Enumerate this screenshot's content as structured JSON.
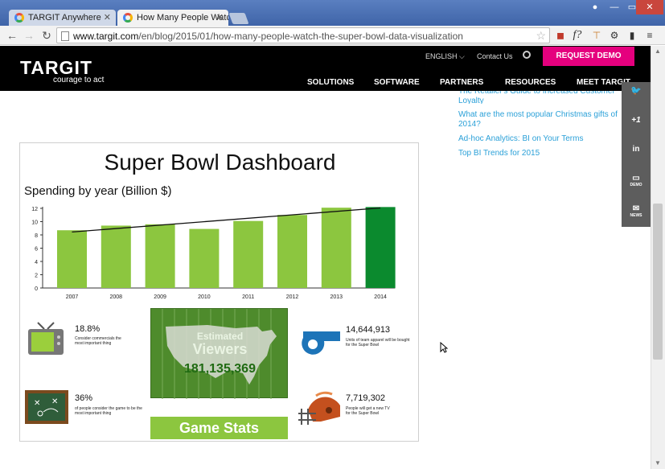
{
  "browser": {
    "tabs": [
      {
        "title": "TARGIT Anywhere",
        "active": false
      },
      {
        "title": "How Many People Watch",
        "active": true
      }
    ],
    "url_host": "www.targit.com",
    "url_path": "/en/blog/2015/01/how-many-people-watch-the-super-bowl-data-visualization",
    "icons": [
      "back-arrow-icon",
      "forward-arrow-icon",
      "reload-icon",
      "star-icon",
      "pocket-icon",
      "formula-icon",
      "extension-icon",
      "gear-icon",
      "bookmark-icon",
      "menu-icon"
    ]
  },
  "header": {
    "logo": "TARGIT",
    "tagline": "courage to act",
    "language": "ENGLISH",
    "contact": "Contact Us",
    "demo_button": "REQUEST DEMO",
    "nav": [
      "SOLUTIONS",
      "SOFTWARE",
      "PARTNERS",
      "RESOURCES",
      "MEET TARGIT"
    ]
  },
  "sidebar": {
    "links": [
      "The Retailer's Guide to Increased Customer Loyalty",
      "What are the most popular Christmas gifts of 2014?",
      "Ad-hoc Analytics: BI on Your Terms",
      "Top BI Trends for 2015"
    ]
  },
  "social": {
    "items": [
      {
        "label": "",
        "icon": "twitter-icon"
      },
      {
        "label": "+1",
        "icon": "google-plus-icon"
      },
      {
        "label": "in",
        "icon": "linkedin-icon"
      },
      {
        "label": "DEMO",
        "icon": "monitor-icon"
      },
      {
        "label": "NEWS",
        "icon": "envelope-icon"
      }
    ]
  },
  "infographic": {
    "title": "Super Bowl Dashboard",
    "chart_subtitle": "Spending by year (Billion $)",
    "stats": [
      {
        "value": "18.8%",
        "text": "Consider commercials the most important thing",
        "icon": "tv-icon"
      },
      {
        "value": "36%",
        "text": "of people consider the game to be the most important thing",
        "icon": "playbook-icon"
      },
      {
        "value": "14,644,913",
        "text": "Units of team apparel will be bought for the Super Bowl",
        "icon": "whistle-icon"
      },
      {
        "value": "7,719,302",
        "text": "People will get a new TV for the Super Bowl",
        "icon": "helmet-icon"
      }
    ],
    "viewers_label_1": "Estimated",
    "viewers_label_2": "Viewers",
    "viewers_value": "181,135,369",
    "game_stats": "Game Stats",
    "colors": {
      "bar": "#8cc63f",
      "highlight_bar": "#0b8a2e",
      "field": "#4e8b2c"
    }
  },
  "chart_data": {
    "type": "bar",
    "categories": [
      "2007",
      "2008",
      "2009",
      "2010",
      "2011",
      "2012",
      "2013",
      "2014"
    ],
    "values": [
      8.7,
      9.4,
      9.6,
      8.9,
      10.1,
      11.0,
      12.1,
      12.2
    ],
    "ylim": [
      0,
      12
    ],
    "yticks": [
      0,
      2,
      4,
      6,
      8,
      10,
      12
    ],
    "trendline": true,
    "grid": false,
    "legend": "none"
  }
}
